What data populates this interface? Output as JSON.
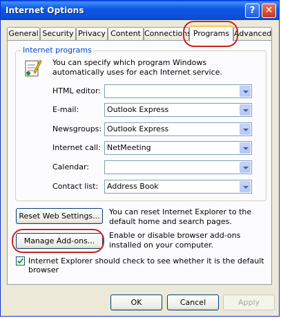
{
  "window": {
    "title": "Internet Options"
  },
  "tabs": [
    {
      "label": "General"
    },
    {
      "label": "Security"
    },
    {
      "label": "Privacy"
    },
    {
      "label": "Content"
    },
    {
      "label": "Connections"
    },
    {
      "label": "Programs"
    },
    {
      "label": "Advanced"
    }
  ],
  "active_tab": "Programs",
  "programs": {
    "group_label": "Internet programs",
    "description": "You can specify which program Windows automatically uses for each Internet service.",
    "fields": [
      {
        "label": "HTML editor:",
        "value": ""
      },
      {
        "label": "E-mail:",
        "value": "Outlook Express"
      },
      {
        "label": "Newsgroups:",
        "value": "Outlook Express"
      },
      {
        "label": "Internet call:",
        "value": "NetMeeting"
      },
      {
        "label": "Calendar:",
        "value": ""
      },
      {
        "label": "Contact list:",
        "value": "Address Book"
      }
    ]
  },
  "reset": {
    "button": "Reset Web Settings...",
    "text": "You can reset Internet Explorer to the default home and search pages."
  },
  "addons": {
    "button": "Manage Add-ons...",
    "text": "Enable or disable browser add-ons installed on your computer."
  },
  "default_check": {
    "checked": true,
    "label": "Internet Explorer should check to see whether it is the default browser"
  },
  "footer": {
    "ok": "OK",
    "cancel": "Cancel",
    "apply": "Apply"
  },
  "highlight_color": "#cf1f1f"
}
